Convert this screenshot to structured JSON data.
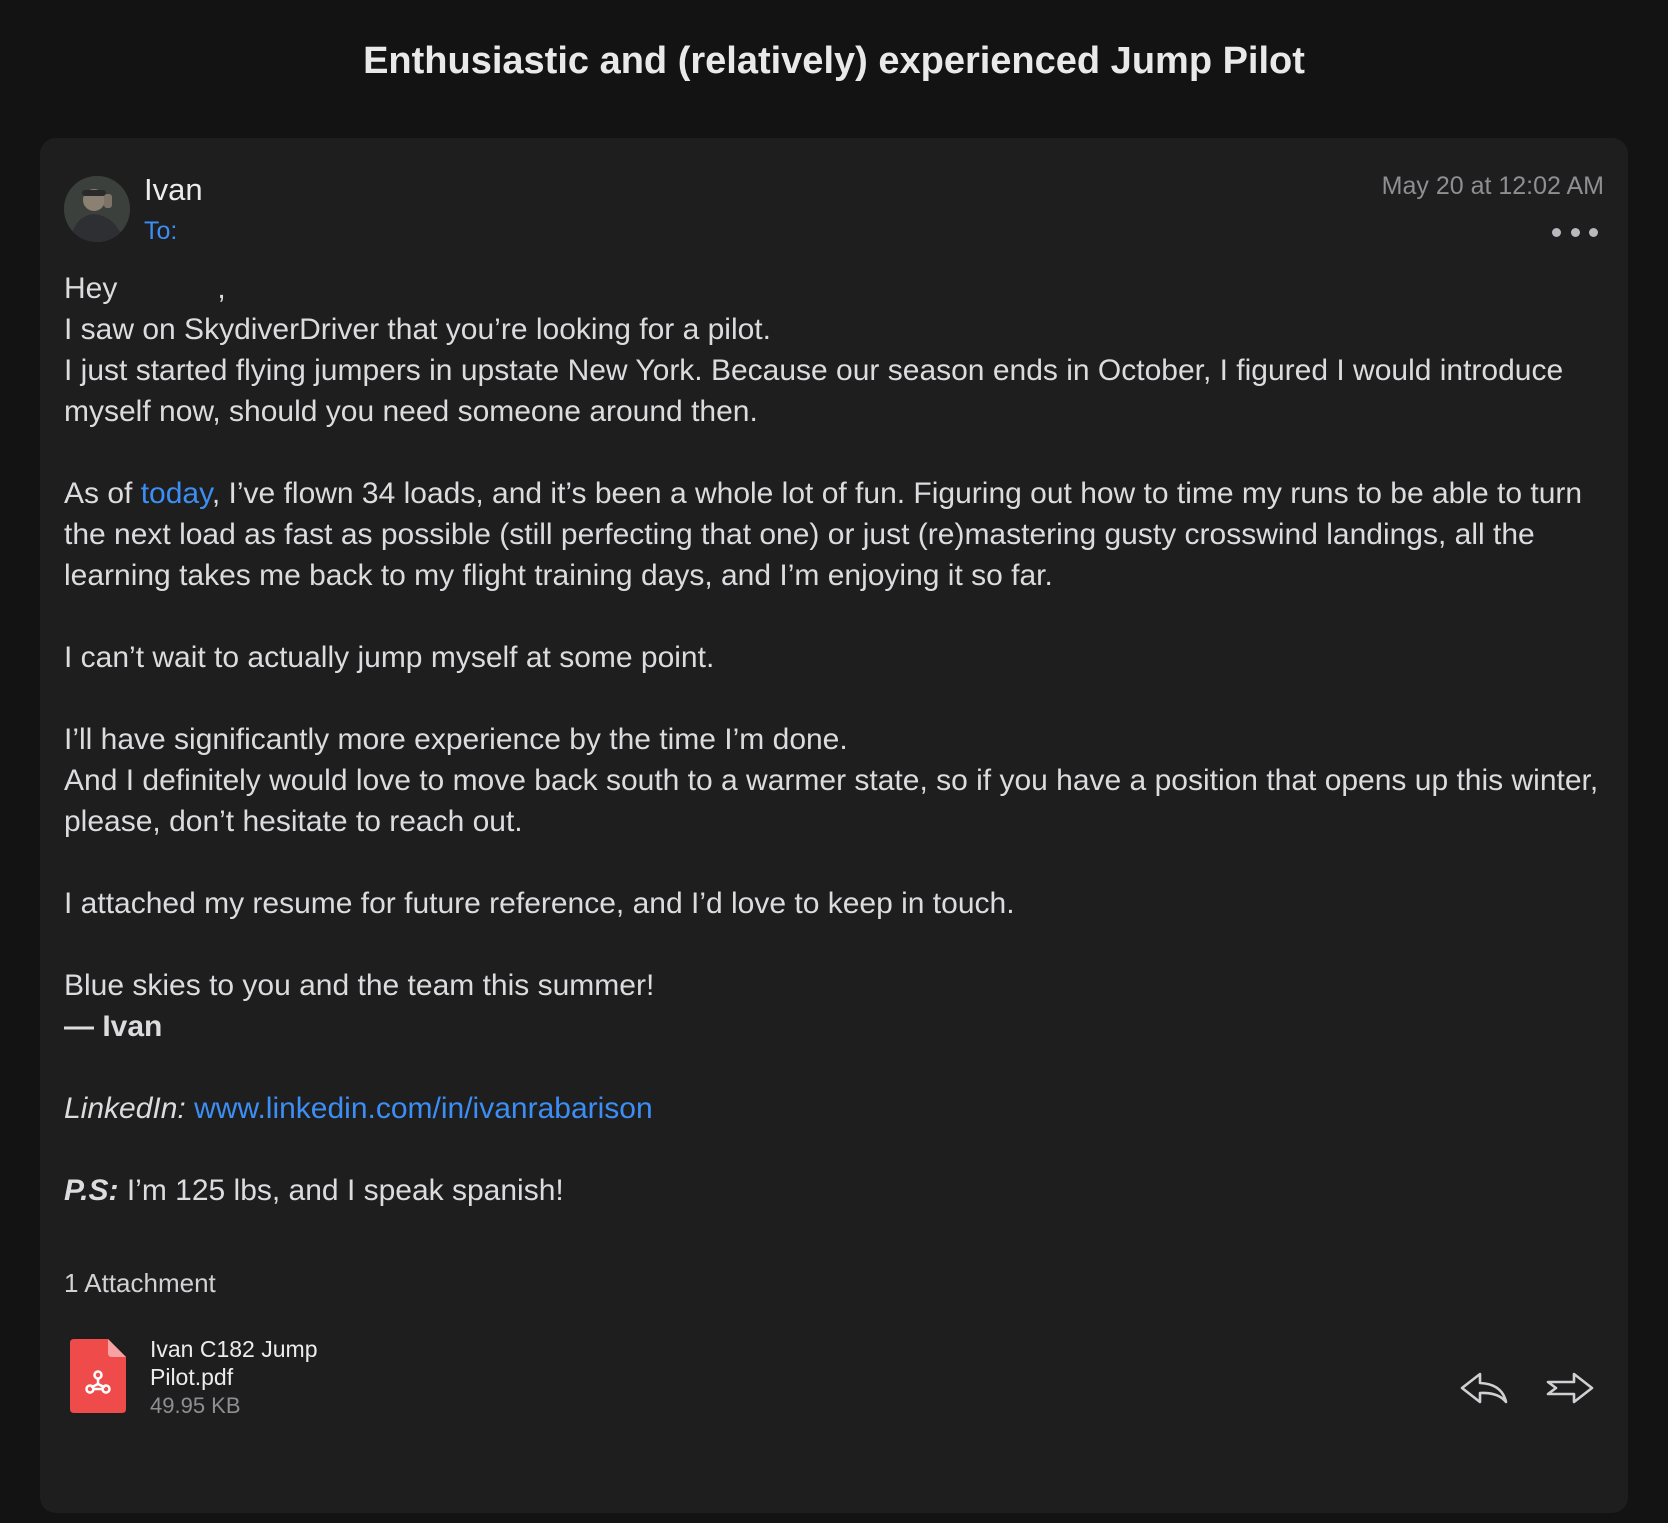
{
  "subject": "Enthusiastic and (relatively) experienced Jump Pilot",
  "message": {
    "sender_name": "Ivan",
    "to_label": "To:",
    "date": "May 20 at 12:02 AM",
    "body": {
      "greeting": "Hey",
      "greeting_comma": ",",
      "line1": "I saw on SkydiverDriver that you’re looking for a pilot.",
      "line2": "I just started flying jumpers in upstate New York. Because our season ends in October, I figured I would introduce myself now, should you need someone around then.",
      "p2_start": "As of ",
      "p2_link": "today",
      "p2_rest": ", I’ve flown 34 loads, and it’s been a whole lot of fun. Figuring out how to time my runs to be able to turn the next load as fast as possible (still perfecting that one) or just (re)mastering gusty crosswind landings, all the learning takes me back to my flight training days, and I’m enjoying it so far.",
      "p3": "I can’t wait to actually jump myself at some point.",
      "p4_line1": "I’ll have significantly more experience by the time I’m done.",
      "p4_line2": "And I definitely would love to move back south to a warmer state, so if you have a position that opens up this winter, please, don’t hesitate to reach out.",
      "p5": "I attached my resume for future reference, and I’d love to keep in touch.",
      "closing": "Blue skies to you and the team this summer!",
      "signature": "— Ivan",
      "linkedin_label": "LinkedIn:",
      "linkedin_url": "www.linkedin.com/in/ivanrabarison",
      "ps_label": "P.S:",
      "ps_text": " I’m 125 lbs, and I speak spanish!"
    },
    "attachments_label": "1 Attachment",
    "attachment": {
      "name": "Ivan C182 Jump Pilot.pdf",
      "size": "49.95 KB",
      "icon": "pdf-file-icon"
    }
  },
  "colors": {
    "background": "#131314",
    "card": "#1e1e1f",
    "link": "#3c8ef5",
    "pdf_red": "#ef4b4b"
  },
  "icons": [
    "more-options-icon",
    "reply-icon",
    "forward-icon",
    "pdf-file-icon"
  ]
}
